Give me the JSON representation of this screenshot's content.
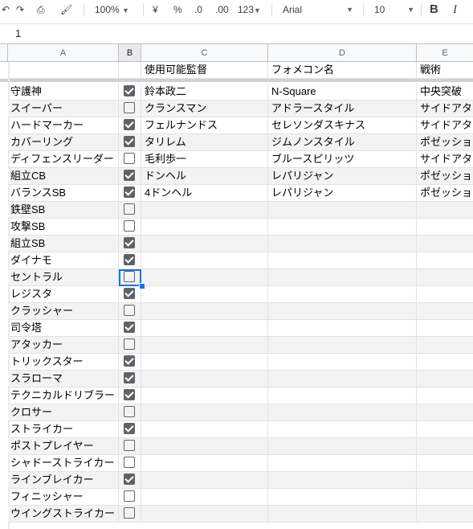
{
  "toolbar": {
    "zoom": "100%",
    "currency": "¥",
    "percent": "%",
    "decrease_decimal": ".0",
    "increase_decimal": ".00",
    "number_format": "123",
    "font": "Arial",
    "font_size": "10",
    "bold": "B",
    "italic": "I"
  },
  "formula_bar": {
    "value": "1"
  },
  "column_headers": [
    "A",
    "B",
    "C",
    "D",
    "E"
  ],
  "header_row": {
    "a": "",
    "c": "使用可能監督",
    "d": "フォメコン名",
    "e": "戦術"
  },
  "rows": [
    {
      "a": "守護神",
      "checked": true,
      "c": "鈴本政二",
      "d": "N-Square",
      "e": "中央突破"
    },
    {
      "a": "スイーパー",
      "checked": false,
      "c": "クランスマン",
      "d": "アドラースタイル",
      "e": "サイドアタ"
    },
    {
      "a": "ハードマーカー",
      "checked": true,
      "c": "フェルナンドス",
      "d": "セレソンダスキナス",
      "e": "サイドアタ"
    },
    {
      "a": "カバーリング",
      "checked": true,
      "c": "タリレム",
      "d": "ジムノンスタイル",
      "e": "ポゼッショ"
    },
    {
      "a": "ディフェンスリーダー",
      "checked": false,
      "c": "毛利歩一",
      "d": "ブルースピリッツ",
      "e": "サイドアタ"
    },
    {
      "a": "組立CB",
      "checked": true,
      "c": "ドンヘル",
      "d": "レパリジャン",
      "e": "ポゼッショ"
    },
    {
      "a": "バランスSB",
      "checked": true,
      "c": "4ドンヘル",
      "d": "レパリジャン",
      "e": "ポゼッショ"
    },
    {
      "a": "鉄壁SB",
      "checked": false,
      "c": "",
      "d": "",
      "e": ""
    },
    {
      "a": "攻撃SB",
      "checked": false,
      "c": "",
      "d": "",
      "e": ""
    },
    {
      "a": "組立SB",
      "checked": true,
      "c": "",
      "d": "",
      "e": ""
    },
    {
      "a": "ダイナモ",
      "checked": true,
      "c": "",
      "d": "",
      "e": ""
    },
    {
      "a": "セントラル",
      "checked": false,
      "c": "",
      "d": "",
      "e": ""
    },
    {
      "a": "レジスタ",
      "checked": true,
      "c": "",
      "d": "",
      "e": ""
    },
    {
      "a": "クラッシャー",
      "checked": false,
      "c": "",
      "d": "",
      "e": ""
    },
    {
      "a": "司令塔",
      "checked": true,
      "c": "",
      "d": "",
      "e": ""
    },
    {
      "a": "アタッカー",
      "checked": false,
      "c": "",
      "d": "",
      "e": ""
    },
    {
      "a": "トリックスター",
      "checked": true,
      "c": "",
      "d": "",
      "e": ""
    },
    {
      "a": "スラローマ",
      "checked": true,
      "c": "",
      "d": "",
      "e": ""
    },
    {
      "a": "テクニカルドリブラー",
      "checked": true,
      "c": "",
      "d": "",
      "e": ""
    },
    {
      "a": "クロサー",
      "checked": false,
      "c": "",
      "d": "",
      "e": ""
    },
    {
      "a": "ストライカー",
      "checked": true,
      "c": "",
      "d": "",
      "e": ""
    },
    {
      "a": "ポストプレイヤー",
      "checked": false,
      "c": "",
      "d": "",
      "e": ""
    },
    {
      "a": "シャドーストライカー",
      "checked": false,
      "c": "",
      "d": "",
      "e": ""
    },
    {
      "a": "ラインブレイカー",
      "checked": true,
      "c": "",
      "d": "",
      "e": ""
    },
    {
      "a": "フィニッシャー",
      "checked": false,
      "c": "",
      "d": "",
      "e": ""
    },
    {
      "a": "ウイングストライカー",
      "checked": false,
      "c": "",
      "d": "",
      "e": ""
    }
  ]
}
